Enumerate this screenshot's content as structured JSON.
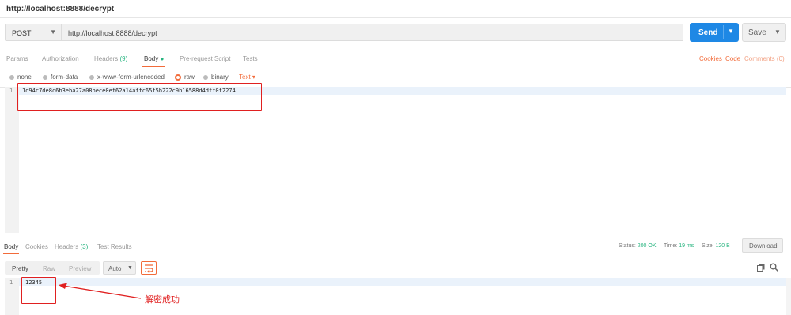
{
  "window": {
    "title": "http://localhost:8888/decrypt"
  },
  "request": {
    "method": "POST",
    "url": "http://localhost:8888/decrypt",
    "send_label": "Send",
    "save_label": "Save"
  },
  "request_tabs": {
    "params": "Params",
    "authorization": "Authorization",
    "headers": "Headers",
    "headers_count": "(9)",
    "body": "Body",
    "body_dot": "●",
    "prerequest": "Pre-request Script",
    "tests": "Tests"
  },
  "right_links": {
    "cookies": "Cookies",
    "code": "Code",
    "comments": "Comments (0)"
  },
  "body_types": {
    "none": "none",
    "form_data": "form-data",
    "urlencoded": "x-www-form-urlencoded",
    "raw": "raw",
    "binary": "binary",
    "selected": "raw",
    "text_type": "Text ▾"
  },
  "request_body": {
    "line_number": "1",
    "content": "1d94c7de8c6b3eba27a08bece0ef62a14affc65f5b222c9b16588d4dff0f2274"
  },
  "response_tabs": {
    "body": "Body",
    "cookies": "Cookies",
    "headers": "Headers",
    "headers_count": "(3)",
    "test_results": "Test Results"
  },
  "response_status": {
    "status_label": "Status:",
    "status_value": "200 OK",
    "time_label": "Time:",
    "time_value": "19 ms",
    "size_label": "Size:",
    "size_value": "120 B",
    "download_label": "Download"
  },
  "response_format": {
    "pretty": "Pretty",
    "raw": "Raw",
    "preview": "Preview",
    "auto": "Auto",
    "selected": "Pretty"
  },
  "response_body": {
    "line_number": "1",
    "content": "12345"
  },
  "annotation": {
    "text": "解密成功"
  },
  "colors": {
    "accent": "#f26b3a",
    "send": "#1e88e5",
    "success": "#26b47f",
    "annotation": "#e02020"
  }
}
